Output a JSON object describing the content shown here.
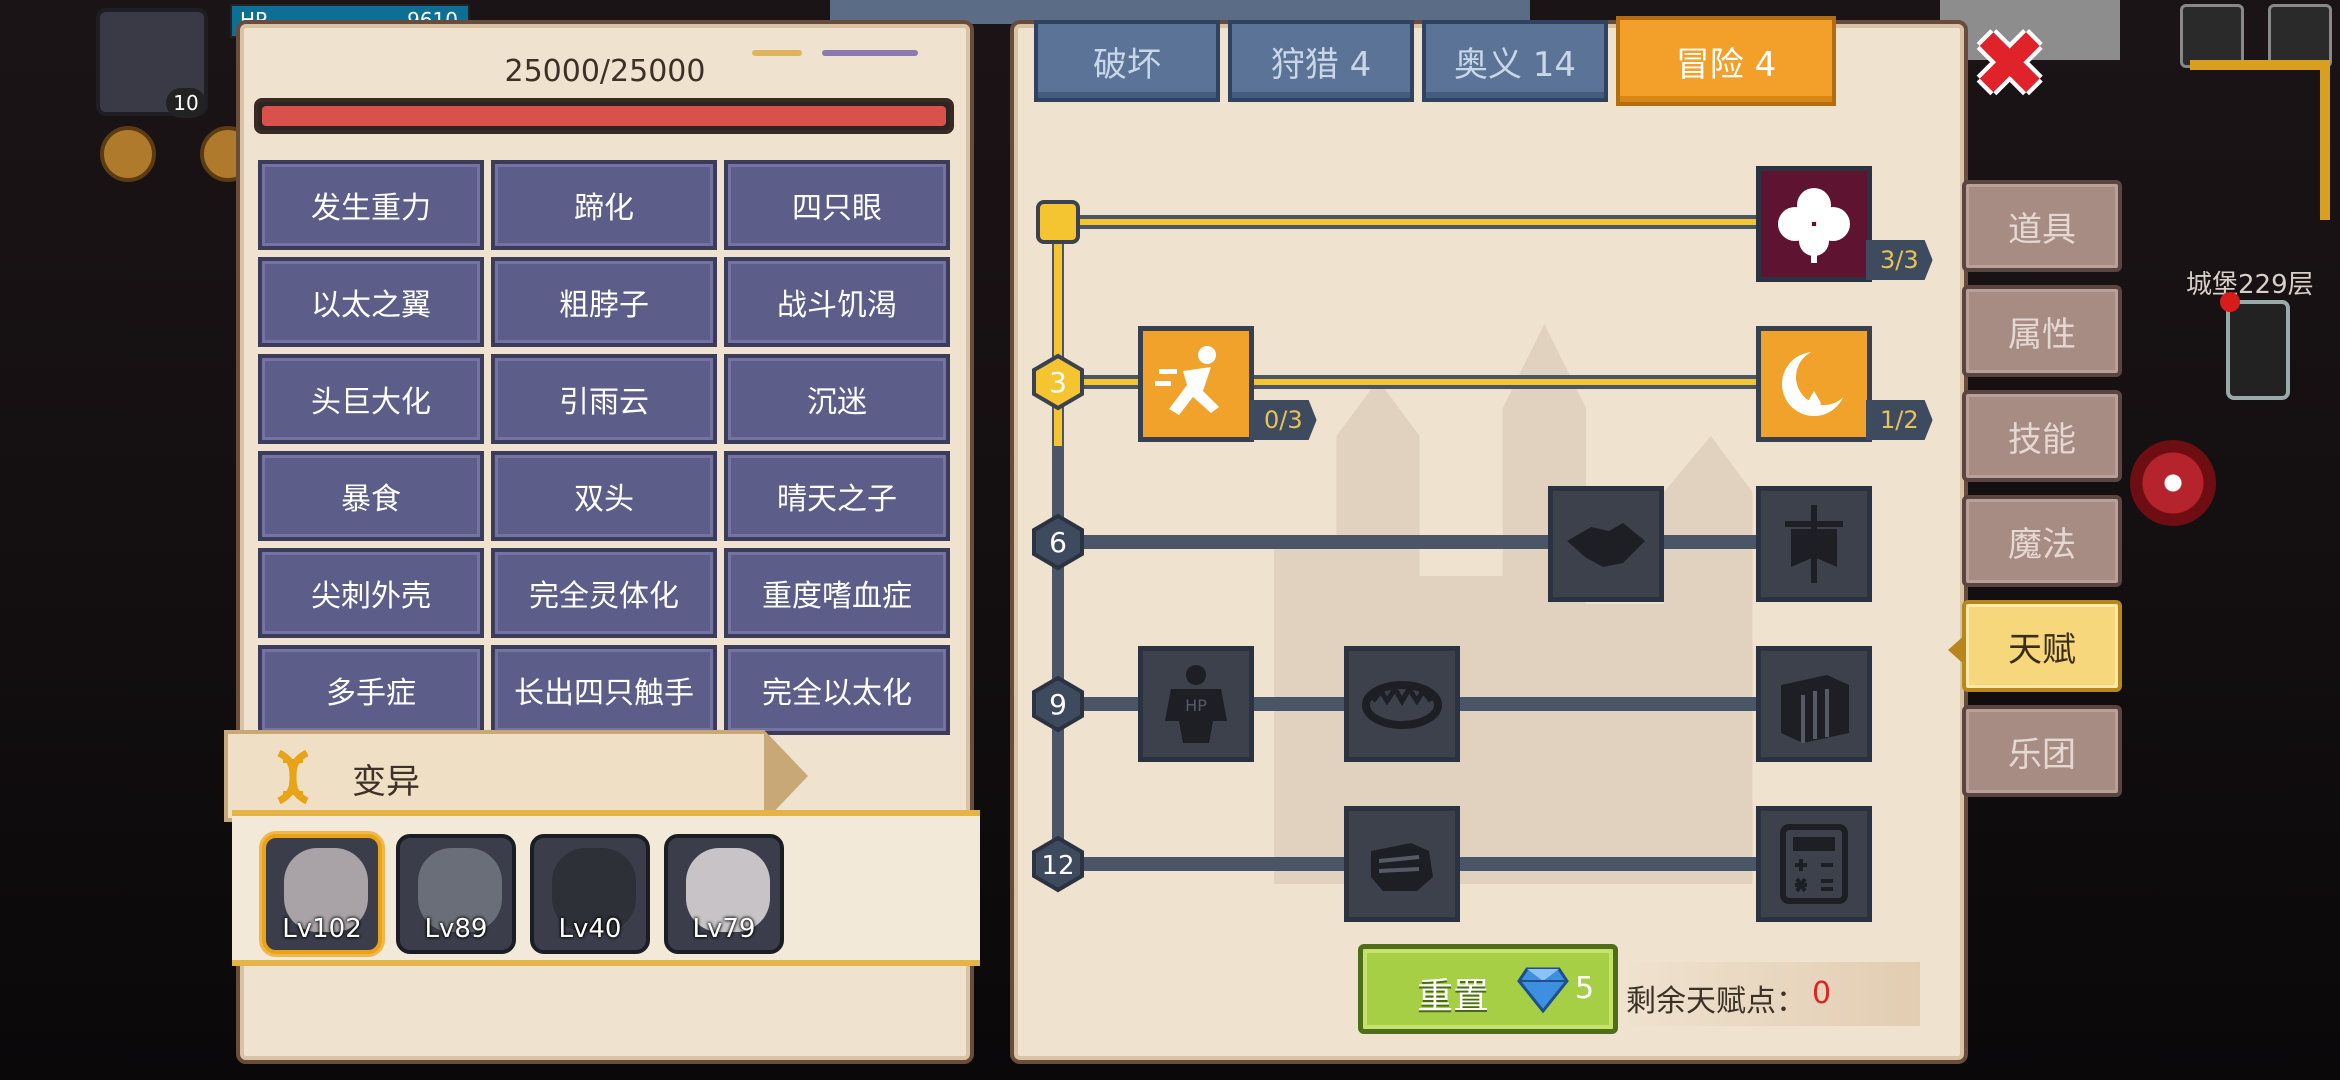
{
  "hud": {
    "hp_label": "HP",
    "hp_value": "9610",
    "level_badge": "10",
    "floor_text": "城堡229层"
  },
  "left_panel": {
    "hp_text": "25000/25000",
    "hp_fraction": 1.0,
    "mutations": [
      "发生重力",
      "蹄化",
      "四只眼",
      "以太之翼",
      "粗脖子",
      "战斗饥渴",
      "头巨大化",
      "引雨云",
      "沉迷",
      "暴食",
      "双头",
      "晴天之子",
      "尖刺外壳",
      "完全灵体化",
      "重度嗜血症",
      "多手症",
      "长出四只触手",
      "完全以太化"
    ],
    "section_title": "变异",
    "characters": [
      {
        "level": "Lv102",
        "selected": true
      },
      {
        "level": "Lv89",
        "selected": false
      },
      {
        "level": "Lv40",
        "selected": false
      },
      {
        "level": "Lv79",
        "selected": false
      }
    ]
  },
  "tabs": [
    {
      "label": "破坏",
      "active": false
    },
    {
      "label": "狩猎 4",
      "active": false
    },
    {
      "label": "奥义 14",
      "active": false
    },
    {
      "label": "冒险 4",
      "active": true
    }
  ],
  "talent_tree": {
    "tier_labels": [
      "3",
      "6",
      "9",
      "12"
    ],
    "nodes": [
      {
        "icon": "clover-icon",
        "count": "3/3",
        "lit": true
      },
      {
        "icon": "dash-icon",
        "count": "0/3",
        "lit": true
      },
      {
        "icon": "crescent-icon",
        "count": "1/2",
        "lit": true
      },
      {
        "icon": "handshake-icon",
        "count": "",
        "lit": false
      },
      {
        "icon": "banner-icon",
        "count": "",
        "lit": false
      },
      {
        "icon": "hp-body-icon",
        "count": "",
        "lit": false
      },
      {
        "icon": "bear-trap-icon",
        "count": "",
        "lit": false
      },
      {
        "icon": "crate-icon",
        "count": "",
        "lit": false
      },
      {
        "icon": "fist-icon",
        "count": "",
        "lit": false
      },
      {
        "icon": "calculator-icon",
        "count": "",
        "lit": false
      }
    ]
  },
  "reset": {
    "label": "重置",
    "gem_cost": "5"
  },
  "remaining": {
    "label": "剩余天赋点：",
    "value": "0"
  },
  "side_menu": [
    {
      "label": "道具",
      "active": false
    },
    {
      "label": "属性",
      "active": false
    },
    {
      "label": "技能",
      "active": false
    },
    {
      "label": "魔法",
      "active": false
    },
    {
      "label": "天赋",
      "active": true
    },
    {
      "label": "乐团",
      "active": false
    }
  ],
  "colors": {
    "accent_orange": "#f2a02a",
    "tab_blue": "#5a7396",
    "mutation_purple": "#5c5d88",
    "reset_green": "#a6cf46",
    "hp_red": "#d8514b",
    "line_gold": "#f5c431",
    "line_slate": "#4a5568"
  }
}
